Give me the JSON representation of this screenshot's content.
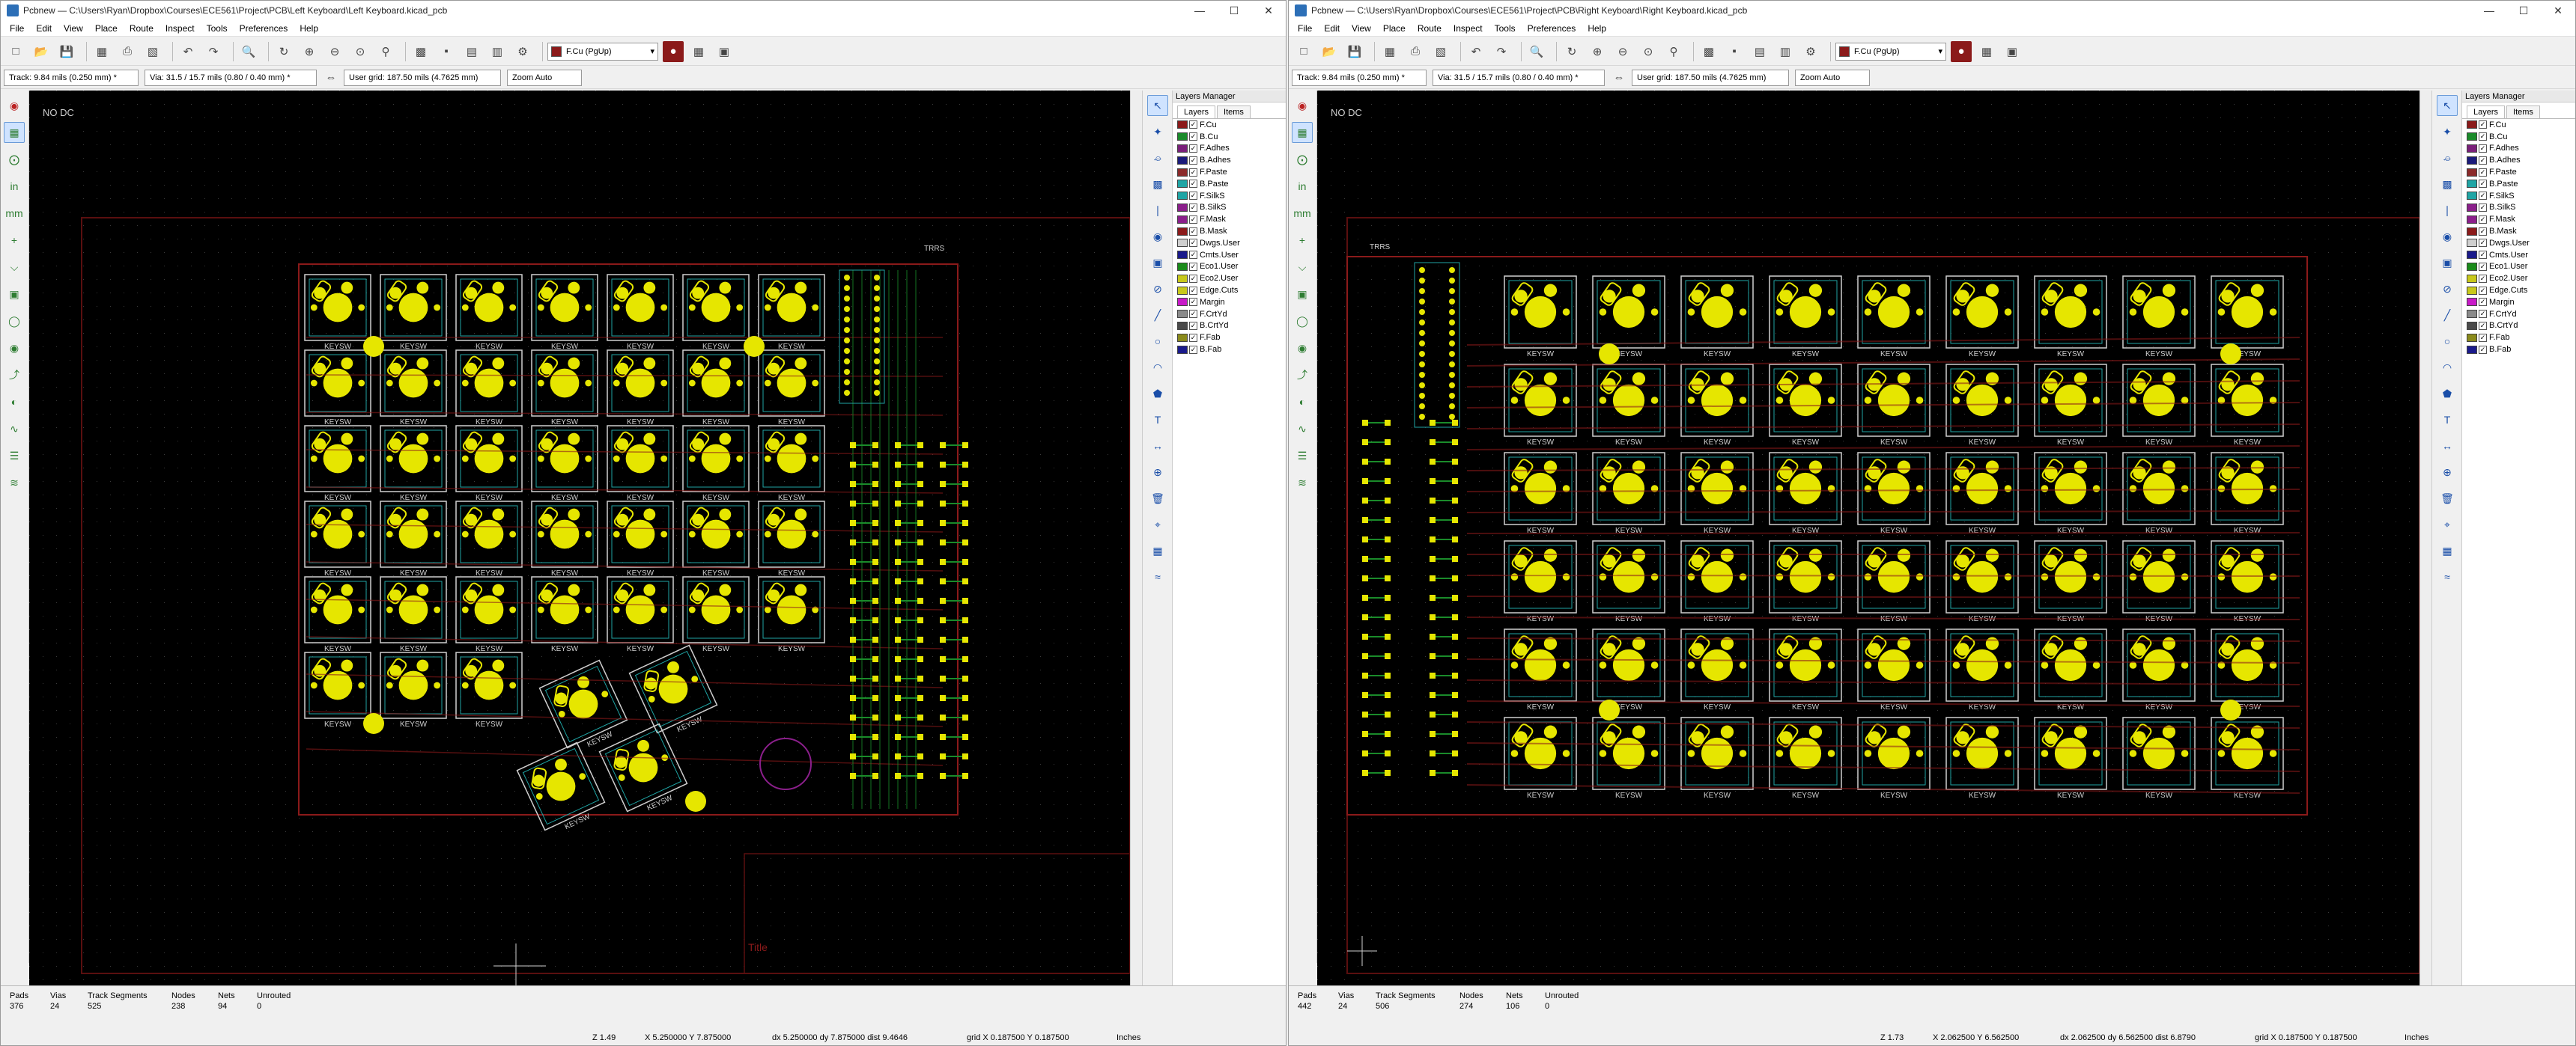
{
  "windows": [
    {
      "id": "left",
      "title": "Pcbnew — C:\\Users\\Ryan\\Dropbox\\Courses\\ECE561\\Project\\PCB\\Left Keyboard\\Left Keyboard.kicad_pcb",
      "menu": [
        "File",
        "Edit",
        "View",
        "Place",
        "Route",
        "Inspect",
        "Tools",
        "Preferences",
        "Help"
      ],
      "layer_select": "F.Cu (PgUp)",
      "track": "Track: 9.84 mils (0.250 mm) *",
      "via": "Via: 31.5 / 15.7 mils (0.80 / 0.40 mm) *",
      "grid": "User grid: 187.50 mils (4.7625 mm)",
      "zoom": "Zoom Auto",
      "canvas_label": "NO DC",
      "layers_title": "Layers Manager",
      "tabs": [
        "Layers",
        "Items"
      ],
      "status": {
        "labels": [
          "Pads",
          "Vias",
          "Track Segments",
          "Nodes",
          "Nets",
          "Unrouted"
        ],
        "values": [
          "376",
          "24",
          "525",
          "238",
          "94",
          "0"
        ],
        "zoom": "Z 1.49",
        "xy": "X 5.250000  Y 7.875000",
        "dxy": "dx 5.250000  dy 7.875000  dist 9.4646",
        "grid": "grid X 0.187500  Y 0.187500",
        "units": "Inches"
      }
    },
    {
      "id": "right",
      "title": "Pcbnew — C:\\Users\\Ryan\\Dropbox\\Courses\\ECE561\\Project\\PCB\\Right Keyboard\\Right Keyboard.kicad_pcb",
      "menu": [
        "File",
        "Edit",
        "View",
        "Place",
        "Route",
        "Inspect",
        "Tools",
        "Preferences",
        "Help"
      ],
      "layer_select": "F.Cu (PgUp)",
      "track": "Track: 9.84 mils (0.250 mm) *",
      "via": "Via: 31.5 / 15.7 mils (0.80 / 0.40 mm) *",
      "grid": "User grid: 187.50 mils (4.7625 mm)",
      "zoom": "Zoom Auto",
      "canvas_label": "NO DC",
      "layers_title": "Layers Manager",
      "tabs": [
        "Layers",
        "Items"
      ],
      "status": {
        "labels": [
          "Pads",
          "Vias",
          "Track Segments",
          "Nodes",
          "Nets",
          "Unrouted"
        ],
        "values": [
          "442",
          "24",
          "506",
          "274",
          "106",
          "0"
        ],
        "zoom": "Z 1.73",
        "xy": "X 2.062500  Y 6.562500",
        "dxy": "dx 2.062500  dy 6.562500  dist 6.8790",
        "grid": "grid X 0.187500  Y 0.187500",
        "units": "Inches"
      }
    }
  ],
  "layers": [
    {
      "name": "F.Cu",
      "color": "#8b1a1a"
    },
    {
      "name": "B.Cu",
      "color": "#1a8b2a"
    },
    {
      "name": "F.Adhes",
      "color": "#7a1f7a"
    },
    {
      "name": "B.Adhes",
      "color": "#1a1a7a"
    },
    {
      "name": "F.Paste",
      "color": "#8b2a2a"
    },
    {
      "name": "B.Paste",
      "color": "#1fa5a5"
    },
    {
      "name": "F.SilkS",
      "color": "#1fa5a5"
    },
    {
      "name": "B.SilkS",
      "color": "#8b1f8b"
    },
    {
      "name": "F.Mask",
      "color": "#8b1f8b"
    },
    {
      "name": "B.Mask",
      "color": "#8b1a1a"
    },
    {
      "name": "Dwgs.User",
      "color": "#cfcfcf"
    },
    {
      "name": "Cmts.User",
      "color": "#1a1a8b"
    },
    {
      "name": "Eco1.User",
      "color": "#1a8b1a"
    },
    {
      "name": "Eco2.User",
      "color": "#c8c81a"
    },
    {
      "name": "Edge.Cuts",
      "color": "#c8c81a"
    },
    {
      "name": "Margin",
      "color": "#c81ac8"
    },
    {
      "name": "F.CrtYd",
      "color": "#8a8a8a"
    },
    {
      "name": "B.CrtYd",
      "color": "#4a4a4a"
    },
    {
      "name": "F.Fab",
      "color": "#8a8a1a"
    },
    {
      "name": "B.Fab",
      "color": "#1a1a8b"
    }
  ],
  "board_text": {
    "key_label": "KEYSW",
    "left_chip": "TRRS",
    "right_chip": "TRRS",
    "title_block": "Title"
  }
}
